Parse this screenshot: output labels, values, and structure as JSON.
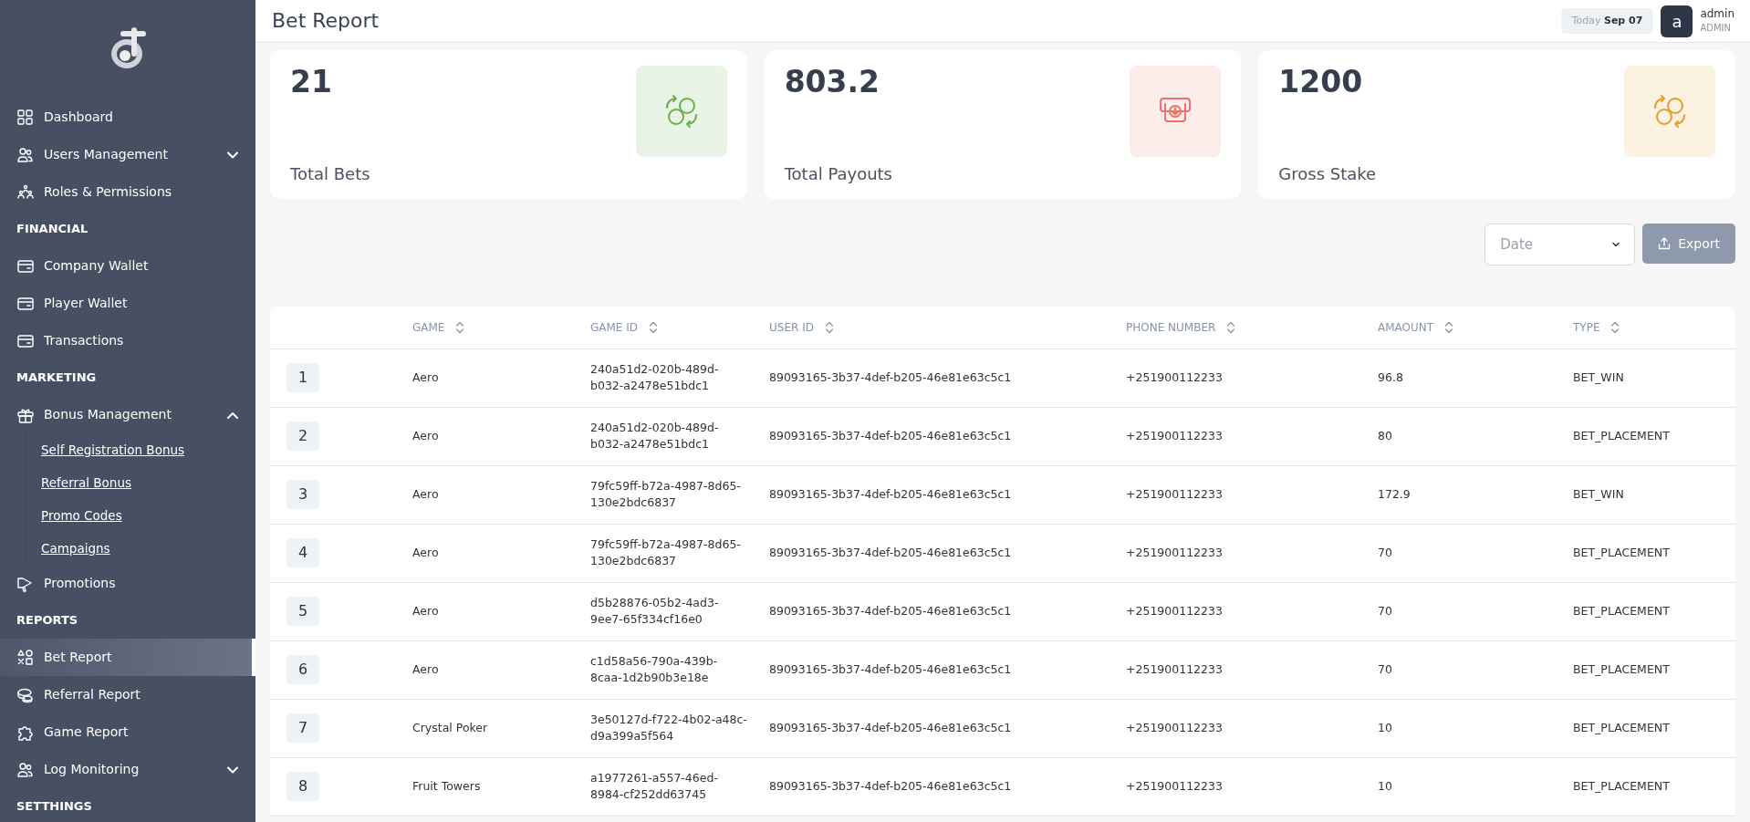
{
  "sidebar": {
    "items": [
      {
        "kind": "item",
        "label": "Dashboard",
        "selected": false
      },
      {
        "kind": "group",
        "label": "Users Management",
        "expanded": false,
        "selected": false
      },
      {
        "kind": "item",
        "label": "Roles & Permissions",
        "selected": false
      },
      {
        "kind": "header",
        "label": "FINANCIAL"
      },
      {
        "kind": "item",
        "label": "Company Wallet",
        "selected": false
      },
      {
        "kind": "item",
        "label": "Player Wallet",
        "selected": false
      },
      {
        "kind": "item",
        "label": "Transactions",
        "selected": false
      },
      {
        "kind": "header",
        "label": "MARKETING"
      },
      {
        "kind": "group",
        "label": "Bonus Management",
        "expanded": true,
        "selected": false,
        "children": [
          {
            "label": "Self Registration Bonus",
            "selected": false
          },
          {
            "label": "Referral Bonus",
            "selected": false
          },
          {
            "label": "Promo Codes",
            "selected": false
          },
          {
            "label": "Campaigns",
            "selected": false
          }
        ]
      },
      {
        "kind": "item",
        "label": "Promotions",
        "selected": false
      },
      {
        "kind": "header",
        "label": "REPORTS"
      },
      {
        "kind": "item",
        "label": "Bet Report",
        "selected": true
      },
      {
        "kind": "item",
        "label": "Referral Report",
        "selected": false
      },
      {
        "kind": "item",
        "label": "Game Report",
        "selected": false
      },
      {
        "kind": "group",
        "label": "Log Monitoring",
        "expanded": false,
        "selected": false
      },
      {
        "kind": "header",
        "label": "SETTHINGS"
      }
    ]
  },
  "header": {
    "title": "Bet Report",
    "date_prefix": "Today",
    "date": "Sep 07",
    "avatar_letter": "a",
    "user_name": "admin",
    "user_role": "ADMIN"
  },
  "stats": [
    {
      "value": "21",
      "label": "Total Bets",
      "color": "#6ab04c"
    },
    {
      "value": "803.2",
      "label": "Total Payouts",
      "color": "#e8756b"
    },
    {
      "value": "1200",
      "label": "Gross Stake",
      "color": "#e0a030"
    }
  ],
  "filters": {
    "date": {
      "placeholder": "Date"
    },
    "export_button": "Export"
  },
  "table": {
    "columns": [
      "",
      "GAME",
      "GAME ID",
      "USER ID",
      "PHONE NUMBER",
      "AMAOUNT",
      "TYPE"
    ],
    "rows": [
      [
        "1",
        "Aero",
        "240a51d2-020b-489d-b032-a2478e51bdc1",
        "89093165-3b37-4def-b205-46e81e63c5c1",
        "+251900112233",
        "96.8",
        "BET_WIN"
      ],
      [
        "2",
        "Aero",
        "240a51d2-020b-489d-b032-a2478e51bdc1",
        "89093165-3b37-4def-b205-46e81e63c5c1",
        "+251900112233",
        "80",
        "BET_PLACEMENT"
      ],
      [
        "3",
        "Aero",
        "79fc59ff-b72a-4987-8d65-130e2bdc6837",
        "89093165-3b37-4def-b205-46e81e63c5c1",
        "+251900112233",
        "172.9",
        "BET_WIN"
      ],
      [
        "4",
        "Aero",
        "79fc59ff-b72a-4987-8d65-130e2bdc6837",
        "89093165-3b37-4def-b205-46e81e63c5c1",
        "+251900112233",
        "70",
        "BET_PLACEMENT"
      ],
      [
        "5",
        "Aero",
        "d5b28876-05b2-4ad3-9ee7-65f334cf16e0",
        "89093165-3b37-4def-b205-46e81e63c5c1",
        "+251900112233",
        "70",
        "BET_PLACEMENT"
      ],
      [
        "6",
        "Aero",
        "c1d58a56-790a-439b-8caa-1d2b90b3e18e",
        "89093165-3b37-4def-b205-46e81e63c5c1",
        "+251900112233",
        "70",
        "BET_PLACEMENT"
      ],
      [
        "7",
        "Crystal Poker",
        "3e50127d-f722-4b02-a48c-d9a399a5f564",
        "89093165-3b37-4def-b205-46e81e63c5c1",
        "+251900112233",
        "10",
        "BET_PLACEMENT"
      ],
      [
        "8",
        "Fruit Towers",
        "a1977261-a557-46ed-8984-cf252dd63745",
        "89093165-3b37-4def-b205-46e81e63c5c1",
        "+251900112233",
        "10",
        "BET_PLACEMENT"
      ]
    ]
  }
}
